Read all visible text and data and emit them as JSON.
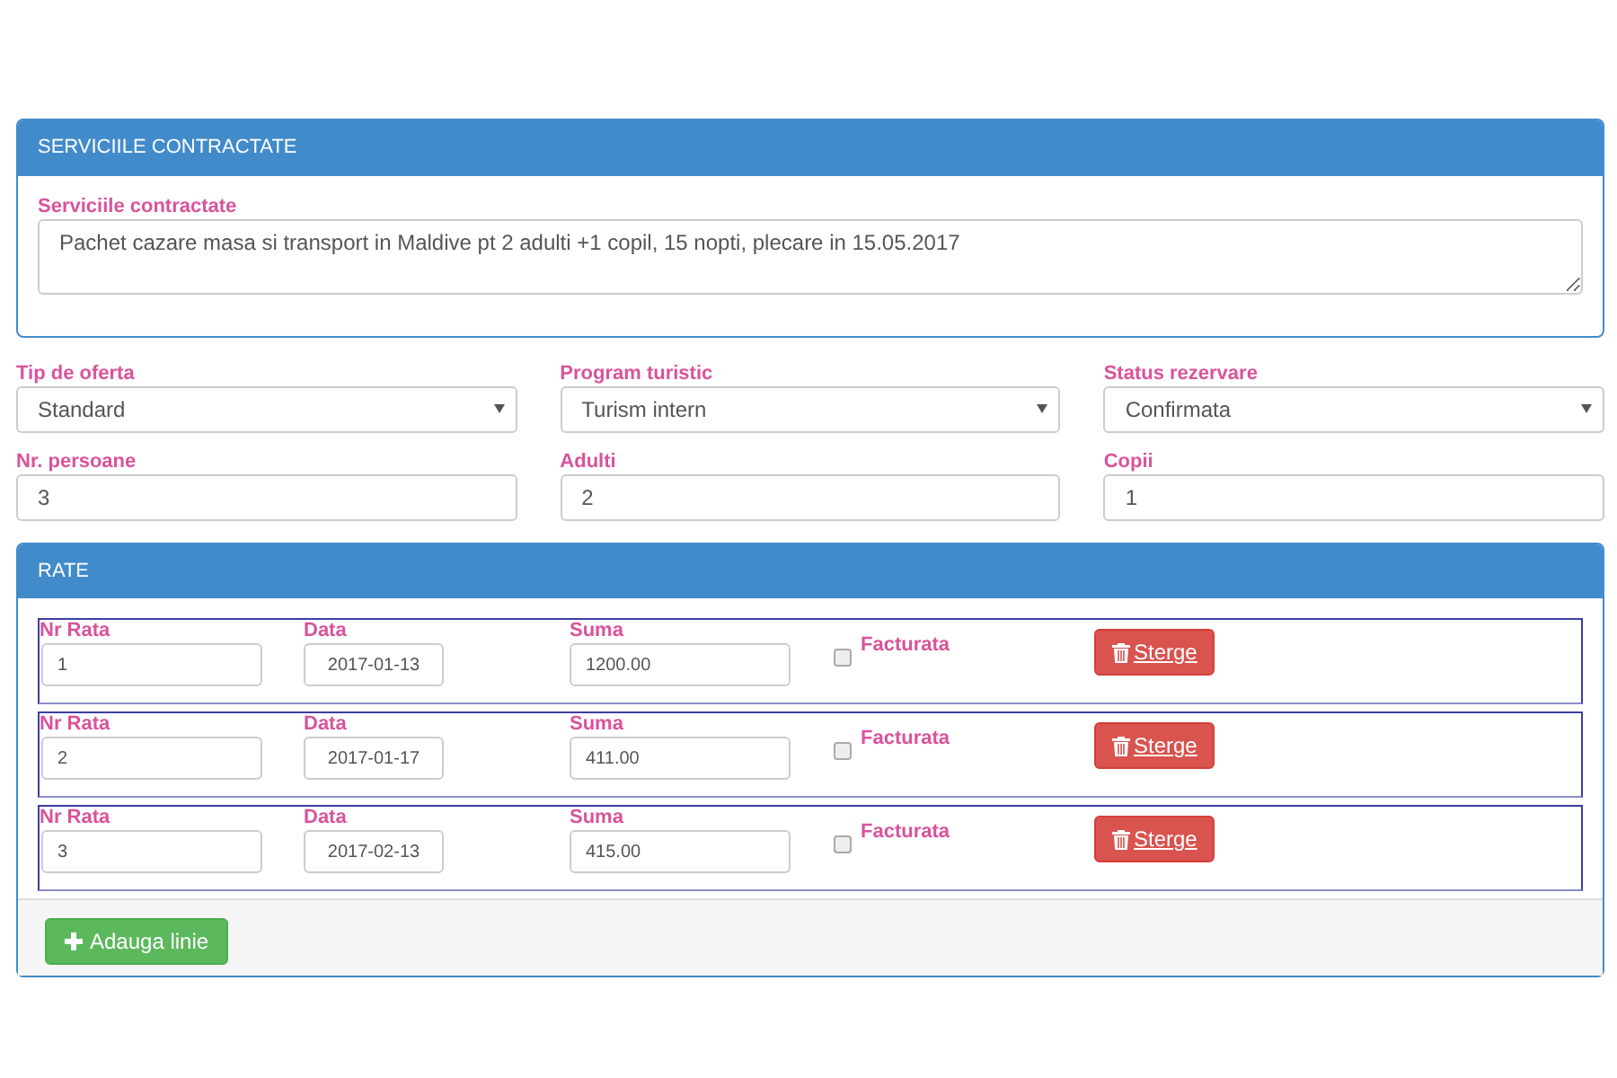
{
  "services_panel": {
    "title": "SERVICIILE CONTRACTATE",
    "label": "Serviciile contractate",
    "value": "Pachet cazare masa si transport in Maldive pt 2 adulti +1 copil, 15 nopti, plecare in 15.05.2017"
  },
  "fields": [
    {
      "kind": "select",
      "label": "Tip de oferta",
      "value": "Standard"
    },
    {
      "kind": "select",
      "label": "Program turistic",
      "value": "Turism intern"
    },
    {
      "kind": "select",
      "label": "Status rezervare",
      "value": "Confirmata"
    },
    {
      "kind": "input",
      "label": "Nr. persoane",
      "value": "3"
    },
    {
      "kind": "input",
      "label": "Adulti",
      "value": "2"
    },
    {
      "kind": "input",
      "label": "Copii",
      "value": "1"
    }
  ],
  "rates_panel": {
    "title": "RATE",
    "rows": [
      {
        "nr_label": "Nr Rata",
        "nr": "1",
        "date_label": "Data",
        "date": "2017-01-13",
        "sum_label": "Suma",
        "sum": "1200.00",
        "invoiced_label": "Facturata",
        "checked": false,
        "delete": "Sterge"
      },
      {
        "nr_label": "Nr Rata",
        "nr": "2",
        "date_label": "Data",
        "date": "2017-01-17",
        "sum_label": "Suma",
        "sum": "411.00",
        "invoiced_label": "Facturata",
        "checked": false,
        "delete": "Sterge"
      },
      {
        "nr_label": "Nr Rata",
        "nr": "3",
        "date_label": "Data",
        "date": "2017-02-13",
        "sum_label": "Suma",
        "sum": "415.00",
        "invoiced_label": "Facturata",
        "checked": false,
        "delete": "Sterge"
      }
    ],
    "add_button": "Adauga linie"
  }
}
